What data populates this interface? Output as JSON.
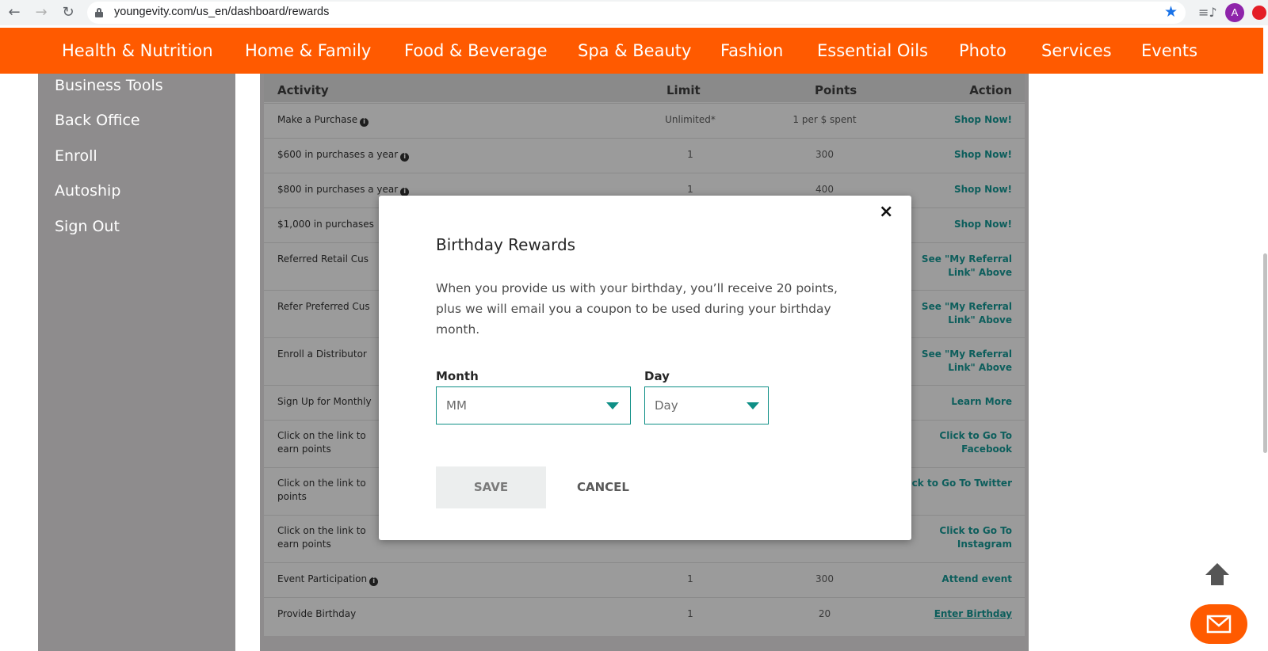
{
  "browser": {
    "url": "youngevity.com/us_en/dashboard/rewards",
    "profile_initial": "A"
  },
  "topnav": {
    "items": [
      "Health & Nutrition",
      "Home & Family",
      "Food & Beverage",
      "Spa & Beauty",
      "Fashion",
      "Essential Oils",
      "Photo",
      "Services",
      "Events"
    ]
  },
  "sidebar": {
    "items": [
      "Business Tools",
      "Back Office",
      "Enroll",
      "Autoship",
      "Sign Out"
    ]
  },
  "table": {
    "headers": [
      "Activity",
      "Limit",
      "Points",
      "Action"
    ],
    "rows": [
      {
        "activity": "Make a Purchase",
        "limit": "Unlimited*",
        "points": "1 per $ spent",
        "action": "Shop Now!"
      },
      {
        "activity": "$600 in purchases a year",
        "limit": "1",
        "points": "300",
        "action": "Shop Now!"
      },
      {
        "activity": "$800 in purchases a year",
        "limit": "1",
        "points": "400",
        "action": "Shop Now!"
      },
      {
        "activity": "$1,000 in purchases",
        "limit": "",
        "points": "",
        "action": "Shop Now!"
      },
      {
        "activity": "Referred Retail Cus",
        "limit": "",
        "points": "",
        "action_line1": "See \"My Referral",
        "action_line2": "Link\" Above"
      },
      {
        "activity": "Refer Preferred Cus",
        "limit": "",
        "points": "",
        "action_line1": "See \"My Referral",
        "action_line2": "Link\" Above"
      },
      {
        "activity": "Enroll a Distributor",
        "limit": "",
        "points": "",
        "action_line1": "See \"My Referral",
        "action_line2": "Link\" Above"
      },
      {
        "activity": "Sign Up for Monthly",
        "limit": "",
        "points": "",
        "action": "Learn More"
      },
      {
        "activity_line1": "Click on the link to",
        "activity_line2": "earn points",
        "action_line1": "Click to Go To",
        "action_line2": "Facebook"
      },
      {
        "activity_line1": "Click on the link to",
        "activity_line2": "points",
        "action": "lick to Go To Twitter"
      },
      {
        "activity_line1": "Click on the link to",
        "activity_line2": "earn points",
        "action_line1": "Click to Go To",
        "action_line2": "Instagram"
      },
      {
        "activity": "Event Participation",
        "limit": "1",
        "points": "300",
        "action": "Attend event"
      },
      {
        "activity": "Provide Birthday",
        "limit": "1",
        "points": "20",
        "action": "Enter Birthday"
      }
    ]
  },
  "modal": {
    "title": "Birthday Rewards",
    "description": "When you provide us with your birthday, you’ll receive 20 points, plus we will email you a coupon to be used during your birthday month.",
    "month_label": "Month",
    "month_value": "MM",
    "day_label": "Day",
    "day_value": "Day",
    "save_label": "SAVE",
    "cancel_label": "CANCEL",
    "close_glyph": "×"
  },
  "colors": {
    "brand_orange": "#ff5a00",
    "accent_teal": "#0e8f86"
  },
  "icons": {
    "back": "arrow-back-icon",
    "forward": "arrow-forward-icon",
    "reload": "reload-icon",
    "lock": "lock-icon",
    "bookmark": "star-icon",
    "media": "media-queue-icon",
    "scroll_top": "arrow-up-icon",
    "contact": "mail-icon"
  }
}
